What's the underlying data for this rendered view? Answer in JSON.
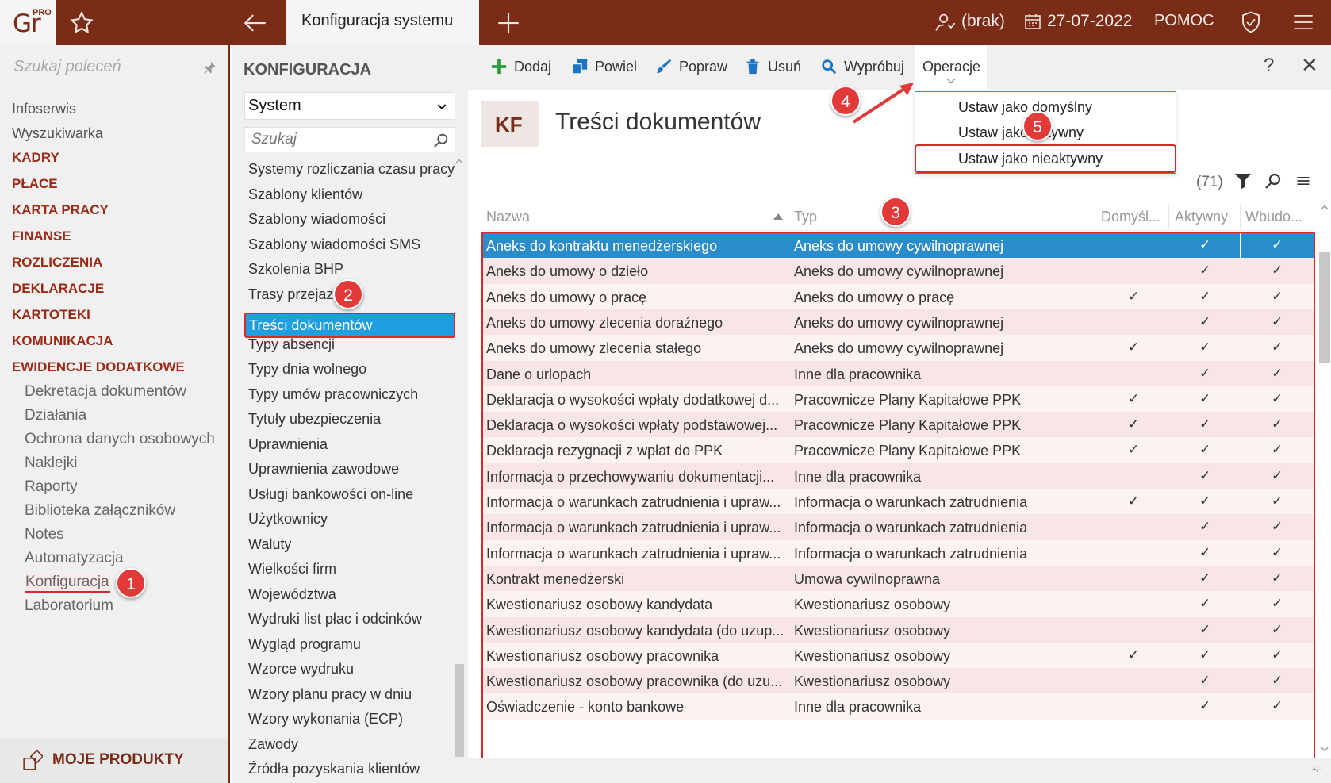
{
  "app": {
    "logo_text": "Gr",
    "logo_badge": "PRO",
    "active_tab": "Konfiguracja systemu",
    "user": "(brak)",
    "date": "27-07-2022",
    "help": "POMOC",
    "brand_color": "#7a2c17",
    "accent_color": "#1f9fe0"
  },
  "sidebar": {
    "search_placeholder": "Szukaj poleceń",
    "items": [
      {
        "label": "Infoserwis",
        "type": "link"
      },
      {
        "label": "Wyszukiwarka",
        "type": "link"
      },
      {
        "label": "KADRY",
        "type": "module"
      },
      {
        "label": "PŁACE",
        "type": "module"
      },
      {
        "label": "KARTA PRACY",
        "type": "module"
      },
      {
        "label": "FINANSE",
        "type": "module"
      },
      {
        "label": "ROZLICZENIA",
        "type": "module"
      },
      {
        "label": "DEKLARACJE",
        "type": "module"
      },
      {
        "label": "KARTOTEKI",
        "type": "module"
      },
      {
        "label": "KOMUNIKACJA",
        "type": "module"
      },
      {
        "label": "EWIDENCJE DODATKOWE",
        "type": "module"
      },
      {
        "label": "Dekretacja dokumentów",
        "type": "sub"
      },
      {
        "label": "Działania",
        "type": "sub"
      },
      {
        "label": "Ochrona danych osobowych",
        "type": "sub"
      },
      {
        "label": "Naklejki",
        "type": "sub"
      },
      {
        "label": "Raporty",
        "type": "sub"
      },
      {
        "label": "Biblioteka załączników",
        "type": "sub"
      },
      {
        "label": "Notes",
        "type": "sub"
      },
      {
        "label": "Automatyzacja",
        "type": "sub"
      },
      {
        "label": "Konfiguracja",
        "type": "sub",
        "active": true
      },
      {
        "label": "Laboratorium",
        "type": "sub"
      }
    ],
    "bottom_label": "MOJE PRODUKTY"
  },
  "config": {
    "title": "KONFIGURACJA",
    "selected": "System",
    "search_placeholder": "Szukaj",
    "items": [
      "Systemy rozliczania czasu pracy",
      "Szablony klientów",
      "Szablony wiadomości",
      "Szablony wiadomości SMS",
      "Szkolenia BHP",
      "Trasy przejazdu",
      "Treści dokumentów",
      "Typy absencji",
      "Typy dnia wolnego",
      "Typy umów pracowniczych",
      "Tytuły ubezpieczenia",
      "Uprawnienia",
      "Uprawnienia zawodowe",
      "Usługi bankowości on-line",
      "Użytkownicy",
      "Waluty",
      "Wielkości firm",
      "Województwa",
      "Wydruki list płac i odcinków",
      "Wygląd programu",
      "Wzorce wydruku",
      "Wzory planu pracy w dniu",
      "Wzory wykonania (ECP)",
      "Zawody",
      "Źródła pozyskania klientów"
    ],
    "active_item": "Treści dokumentów"
  },
  "toolbar": {
    "add": "Dodaj",
    "duplicate": "Powiel",
    "edit": "Popraw",
    "delete": "Usuń",
    "try": "Wypróbuj",
    "operations": "Operacje",
    "help": "?",
    "close": "✕"
  },
  "page": {
    "badge": "KF",
    "title": "Treści dokumentów",
    "count": "(71)"
  },
  "operations_menu": [
    "Ustaw jako domyślny",
    "Ustaw jako aktywny",
    "Ustaw jako nieaktywny"
  ],
  "table": {
    "columns": [
      "Nazwa",
      "Typ",
      "Domyśl...",
      "Aktywny",
      "Wbudo..."
    ],
    "check_glyph": "✓",
    "rows": [
      {
        "name": "Aneks do kontraktu menedżerskiego",
        "type": "Aneks do umowy cywilnoprawnej",
        "default": false,
        "active": true,
        "builtin": true,
        "selected": true
      },
      {
        "name": "Aneks do umowy o dzieło",
        "type": "Aneks do umowy cywilnoprawnej",
        "default": false,
        "active": true,
        "builtin": true
      },
      {
        "name": "Aneks do umowy o pracę",
        "type": "Aneks do umowy o pracę",
        "default": true,
        "active": true,
        "builtin": true
      },
      {
        "name": "Aneks do umowy zlecenia doraźnego",
        "type": "Aneks do umowy cywilnoprawnej",
        "default": false,
        "active": true,
        "builtin": true
      },
      {
        "name": "Aneks do umowy zlecenia stałego",
        "type": "Aneks do umowy cywilnoprawnej",
        "default": true,
        "active": true,
        "builtin": true
      },
      {
        "name": "Dane o urlopach",
        "type": "Inne dla pracownika",
        "default": false,
        "active": true,
        "builtin": true
      },
      {
        "name": "Deklaracja o wysokości wpłaty dodatkowej d...",
        "type": "Pracownicze Plany Kapitałowe PPK",
        "default": true,
        "active": true,
        "builtin": true
      },
      {
        "name": "Deklaracja o wysokości wpłaty podstawowej...",
        "type": "Pracownicze Plany Kapitałowe PPK",
        "default": true,
        "active": true,
        "builtin": true
      },
      {
        "name": "Deklaracja rezygnacji z wpłat do PPK",
        "type": "Pracownicze Plany Kapitałowe PPK",
        "default": true,
        "active": true,
        "builtin": true
      },
      {
        "name": "Informacja o przechowywaniu dokumentacji...",
        "type": "Inne dla pracownika",
        "default": false,
        "active": true,
        "builtin": true
      },
      {
        "name": "Informacja o warunkach zatrudnienia i upraw...",
        "type": "Informacja o warunkach zatrudnienia",
        "default": true,
        "active": true,
        "builtin": true
      },
      {
        "name": "Informacja o warunkach zatrudnienia i upraw...",
        "type": "Informacja o warunkach zatrudnienia",
        "default": false,
        "active": true,
        "builtin": true
      },
      {
        "name": "Informacja o warunkach zatrudnienia i upraw...",
        "type": "Informacja o warunkach zatrudnienia",
        "default": false,
        "active": true,
        "builtin": true
      },
      {
        "name": "Kontrakt menedżerski",
        "type": "Umowa cywilnoprawna",
        "default": false,
        "active": true,
        "builtin": true
      },
      {
        "name": "Kwestionariusz osobowy kandydata",
        "type": "Kwestionariusz osobowy",
        "default": false,
        "active": true,
        "builtin": true
      },
      {
        "name": "Kwestionariusz osobowy kandydata (do uzup...",
        "type": "Kwestionariusz osobowy",
        "default": false,
        "active": true,
        "builtin": true
      },
      {
        "name": "Kwestionariusz osobowy pracownika",
        "type": "Kwestionariusz osobowy",
        "default": true,
        "active": true,
        "builtin": true
      },
      {
        "name": "Kwestionariusz osobowy pracownika (do uzu...",
        "type": "Kwestionariusz osobowy",
        "default": false,
        "active": true,
        "builtin": true
      },
      {
        "name": "Oświadczenie - konto bankowe",
        "type": "Inne dla pracownika",
        "default": false,
        "active": true,
        "builtin": true
      }
    ]
  },
  "annotations": [
    "1",
    "2",
    "3",
    "4",
    "5"
  ],
  "footer_mark": "+/-"
}
